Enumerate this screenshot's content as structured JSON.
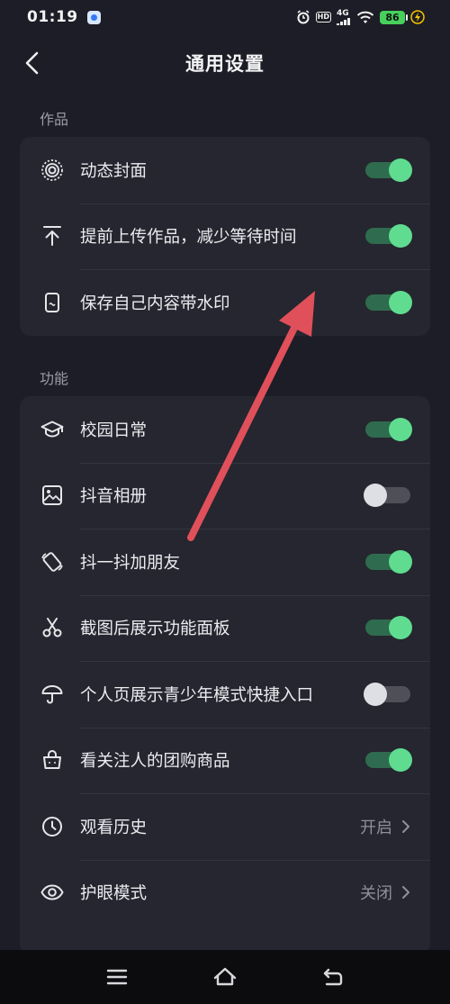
{
  "status_bar": {
    "time": "01:19",
    "hd_label": "HD",
    "network_label": "4G",
    "battery_level": "86"
  },
  "header": {
    "title": "通用设置"
  },
  "sections": [
    {
      "label": "作品",
      "items": [
        {
          "icon": "dynamic-cover-icon",
          "label": "动态封面",
          "type": "toggle",
          "on": true
        },
        {
          "icon": "upload-icon",
          "label": "提前上传作品，减少等待时间",
          "type": "toggle",
          "on": true
        },
        {
          "icon": "phone-watermark-icon",
          "label": "保存自己内容带水印",
          "type": "toggle",
          "on": true
        }
      ]
    },
    {
      "label": "功能",
      "items": [
        {
          "icon": "graduation-cap-icon",
          "label": "校园日常",
          "type": "toggle",
          "on": true
        },
        {
          "icon": "photo-album-icon",
          "label": "抖音相册",
          "type": "toggle",
          "on": false
        },
        {
          "icon": "shake-phone-icon",
          "label": "抖一抖加朋友",
          "type": "toggle",
          "on": true
        },
        {
          "icon": "scissors-icon",
          "label": "截图后展示功能面板",
          "type": "toggle",
          "on": true
        },
        {
          "icon": "umbrella-icon",
          "label": "个人页展示青少年模式快捷入口",
          "type": "toggle",
          "on": false
        },
        {
          "icon": "shopping-bag-icon",
          "label": "看关注人的团购商品",
          "type": "toggle",
          "on": true
        },
        {
          "icon": "clock-icon",
          "label": "观看历史",
          "type": "value",
          "value": "开启"
        },
        {
          "icon": "eye-icon",
          "label": "护眼模式",
          "type": "value",
          "value": "关闭"
        }
      ]
    }
  ],
  "colors": {
    "background": "#1c1d26",
    "card": "#25262f",
    "toggle_on": "#5fdc90",
    "annotation_arrow": "#e0505a"
  }
}
